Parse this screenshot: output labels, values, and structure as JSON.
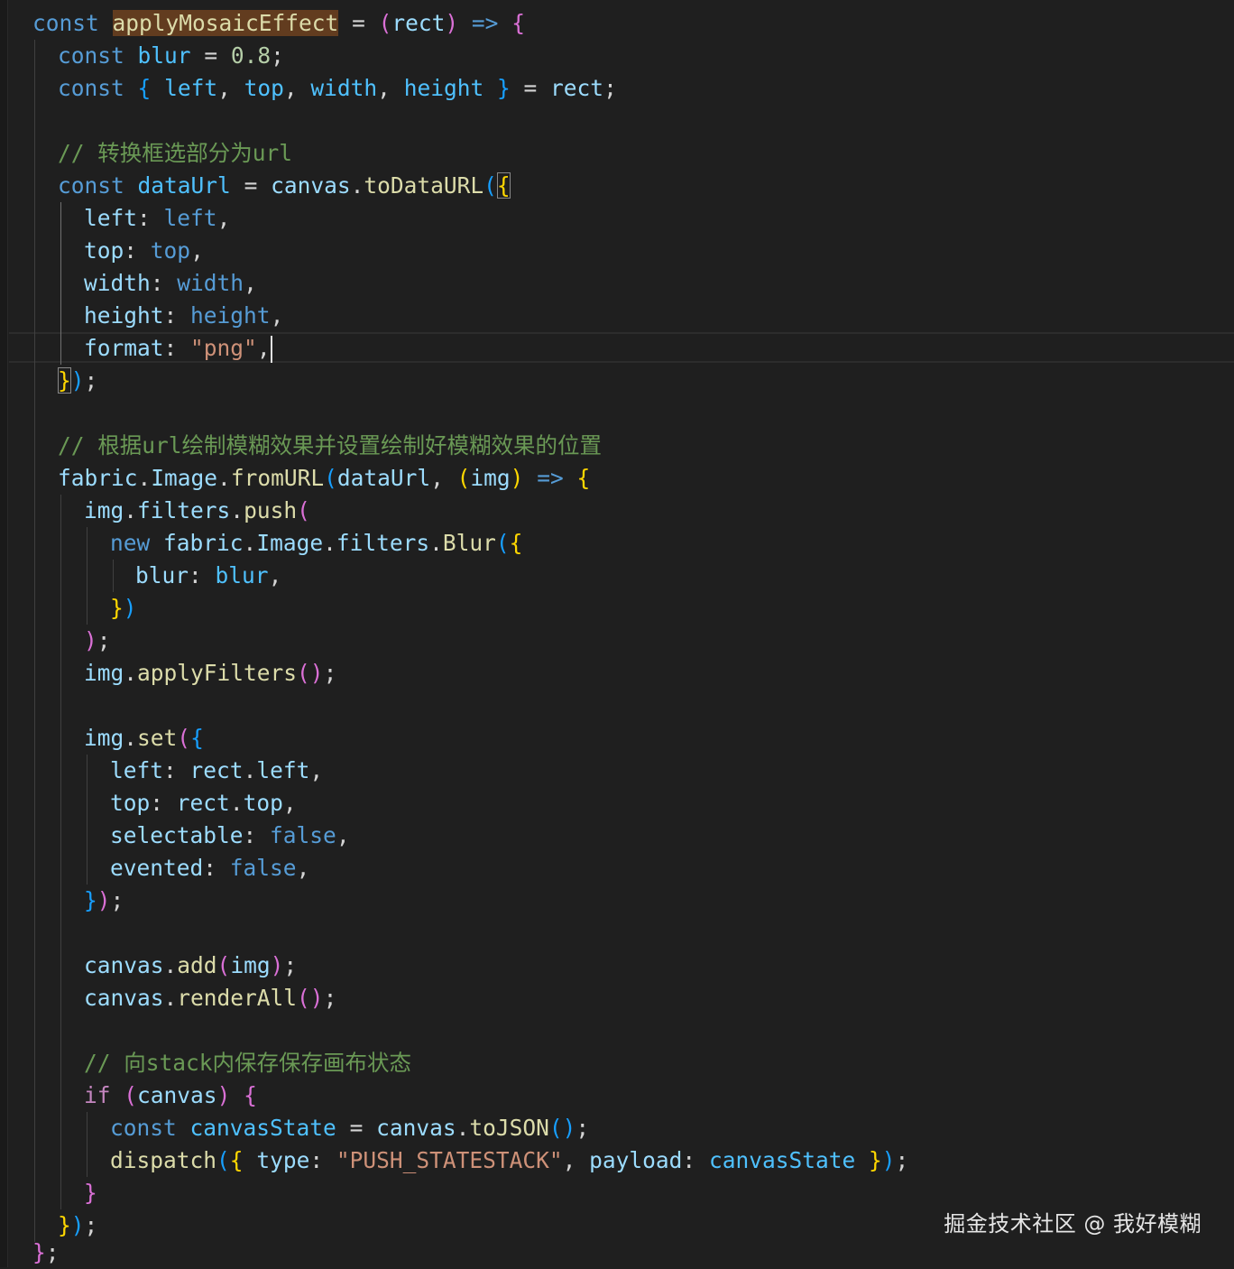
{
  "editor": {
    "function_name": "applyMosaicEffect",
    "rect_param": "rect",
    "blur_value": "0.8",
    "comment_1": "// 转换框选部分为url",
    "comment_2": "// 根据url绘制模糊效果并设置绘制好模糊效果的位置",
    "comment_3": "// 向stack内保存保存画布状态",
    "format_value": "\"png\"",
    "action_type": "\"PUSH_STATESTACK\""
  },
  "watermark": "掘金技术社区 @ 我好模糊",
  "colors": {
    "background": "#1f1f1f",
    "keyword": "#569cd6",
    "function": "#dcdcaa",
    "variable": "#9cdcfe",
    "string": "#ce9178",
    "comment": "#6a9955"
  }
}
